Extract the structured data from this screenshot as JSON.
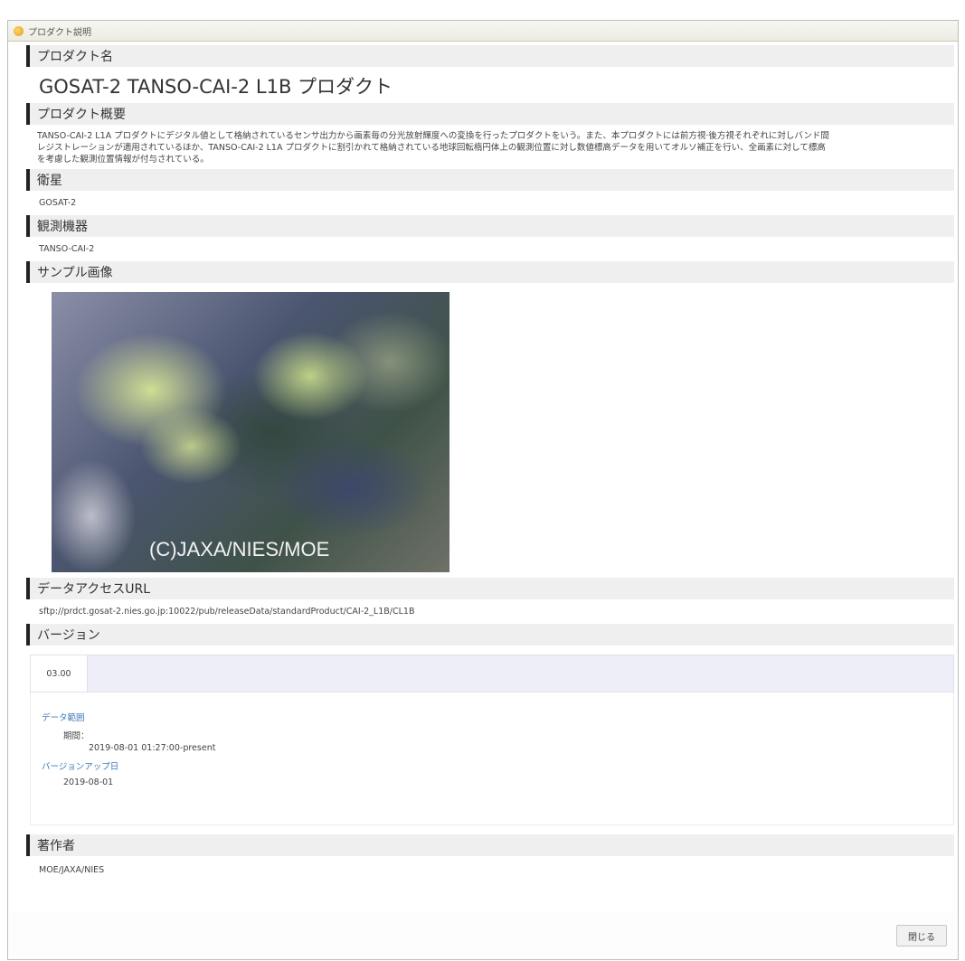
{
  "dialog": {
    "title": "プロダクト説明",
    "close_label": "閉じる"
  },
  "sections": {
    "product_name": {
      "heading": "プロダクト名",
      "value": "GOSAT-2 TANSO-CAI-2 L1B プロダクト"
    },
    "overview": {
      "heading": "プロダクト概要",
      "line1": "TANSO-CAI-2 L1A プロダクトにデジタル値として格納されているセンサ出力から画素毎の分光放射輝度への変換を行ったプロダクトをいう。また、本プロダクトには前方視·後方視それぞれに対しバンド間",
      "line2": "レジストレーションが適用されているほか、TANSO-CAI-2 L1A プロダクトに割引かれて格納されている地球回転楕円体上の観測位置に対し数値標高データを用いてオルソ補正を行い、全画素に対して標高",
      "line3": "を考慮した観測位置情報が付与されている。"
    },
    "satellite": {
      "heading": "衛星",
      "value": "GOSAT-2"
    },
    "instrument": {
      "heading": "観測機器",
      "value": "TANSO-CAI-2"
    },
    "sample_image": {
      "heading": "サンプル画像",
      "watermark": "(C)JAXA/NIES/MOE"
    },
    "data_access": {
      "heading": "データアクセスURL",
      "url": "sftp://prdct.gosat-2.nies.go.jp:10022/pub/releaseData/standardProduct/CAI-2_L1B/CL1B"
    },
    "version": {
      "heading": "バージョン",
      "tab": "03.00",
      "data_range_link": "データ範囲",
      "period_label": "期間：",
      "period_value": "2019-08-01 01:27:00-present",
      "update_link": "バージョンアップ日",
      "update_value": "2019-08-01"
    },
    "author": {
      "heading": "著作者",
      "value": "MOE/JAXA/NIES"
    }
  }
}
